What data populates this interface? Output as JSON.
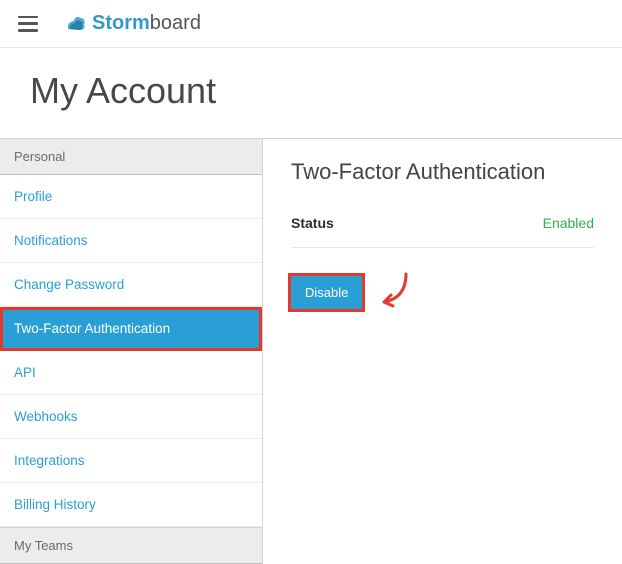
{
  "brand": {
    "part1": "Storm",
    "part2": "board"
  },
  "page_title": "My Account",
  "sidebar": {
    "section1_label": "Personal",
    "items": [
      {
        "label": "Profile"
      },
      {
        "label": "Notifications"
      },
      {
        "label": "Change Password"
      },
      {
        "label": "Two-Factor Authentication"
      },
      {
        "label": "API"
      },
      {
        "label": "Webhooks"
      },
      {
        "label": "Integrations"
      },
      {
        "label": "Billing History"
      }
    ],
    "section2_label": "My Teams"
  },
  "main": {
    "heading": "Two-Factor Authentication",
    "status_label": "Status",
    "status_value": "Enabled",
    "disable_button": "Disable"
  },
  "colors": {
    "accent": "#2a9fd6",
    "success": "#2bb24c",
    "annotation": "#e23b2e"
  }
}
